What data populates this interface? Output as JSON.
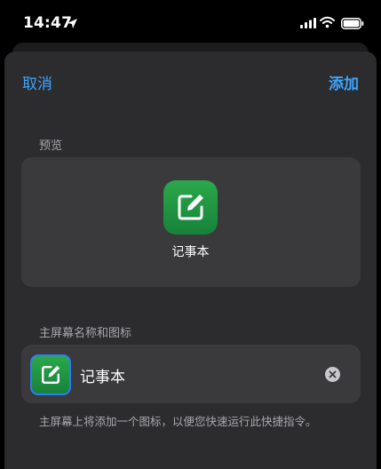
{
  "status_bar": {
    "time": "14:47",
    "icons": [
      "location-arrow-icon",
      "cellular-signal-icon",
      "wifi-icon",
      "battery-icon"
    ]
  },
  "nav": {
    "cancel_label": "取消",
    "add_label": "添加"
  },
  "preview": {
    "section_label": "预览",
    "app_name": "记事本",
    "icon": "notes-edit-icon"
  },
  "home_screen": {
    "section_label": "主屏幕名称和图标",
    "name_value": "记事本",
    "icon": "notes-edit-icon",
    "clear_icon": "clear-icon",
    "footer_note": "主屏幕上将添加一个图标，以便您快速运行此快捷指令。"
  },
  "colors": {
    "accent": "#3da4ff",
    "icon_green": "#1f9a44",
    "sheet_bg": "#2c2c2e",
    "card_bg": "#3a3a3c"
  }
}
